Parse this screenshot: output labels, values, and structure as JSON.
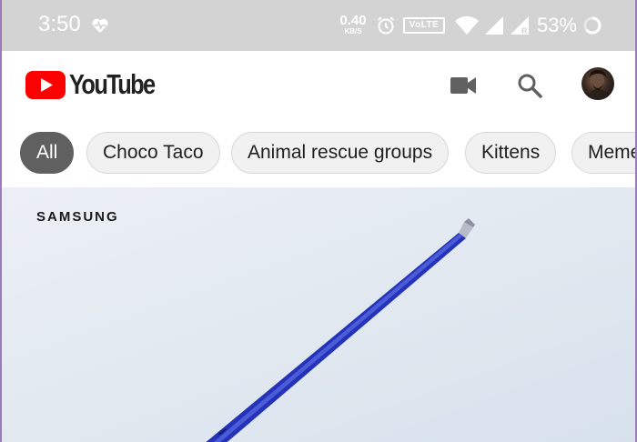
{
  "status_bar": {
    "time": "3:50",
    "net_speed_value": "0.40",
    "net_speed_unit": "KB/S",
    "volte": "VoLTE",
    "battery": "53%",
    "icons": [
      "heart-monitor-icon",
      "alarm-icon",
      "wifi-icon",
      "cell-signal-icon",
      "cell-signal-roaming-icon",
      "battery-icon"
    ]
  },
  "app_bar": {
    "logo_text": "YouTube",
    "brand_color": "#ff0000",
    "actions": [
      "video-camera-icon",
      "search-icon",
      "avatar"
    ]
  },
  "chips": [
    {
      "label": "All",
      "selected": true
    },
    {
      "label": "Choco Taco",
      "selected": false
    },
    {
      "label": "Animal rescue groups",
      "selected": false
    },
    {
      "label": "Kittens",
      "selected": false
    },
    {
      "label": "Memes",
      "selected": false
    }
  ],
  "video": {
    "advertiser": "SAMSUNG"
  }
}
